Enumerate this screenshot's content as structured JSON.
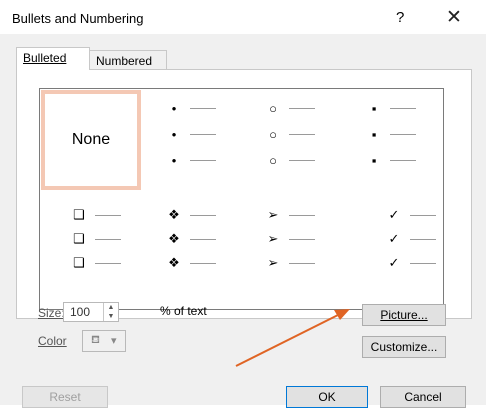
{
  "window": {
    "title": "Bullets and Numbering",
    "help_label": "?",
    "close_label": "✕"
  },
  "tabs": [
    {
      "label": "Bulleted",
      "selected": true
    },
    {
      "label": "Numbered",
      "selected": false
    }
  ],
  "gallery": {
    "none_label": "None",
    "bullets": {
      "round": "•",
      "hollow": "○",
      "square": "▪",
      "box": "❑",
      "diamond": "❖",
      "arrowhead": "➢",
      "check": "✓"
    }
  },
  "size": {
    "label": "Size:",
    "value": "100",
    "suffix": "% of text"
  },
  "color": {
    "label": "Color"
  },
  "buttons": {
    "picture": "Picture...",
    "customize": "Customize...",
    "reset": "Reset",
    "ok": "OK",
    "cancel": "Cancel"
  },
  "annotation": {
    "color": "#e06424"
  }
}
